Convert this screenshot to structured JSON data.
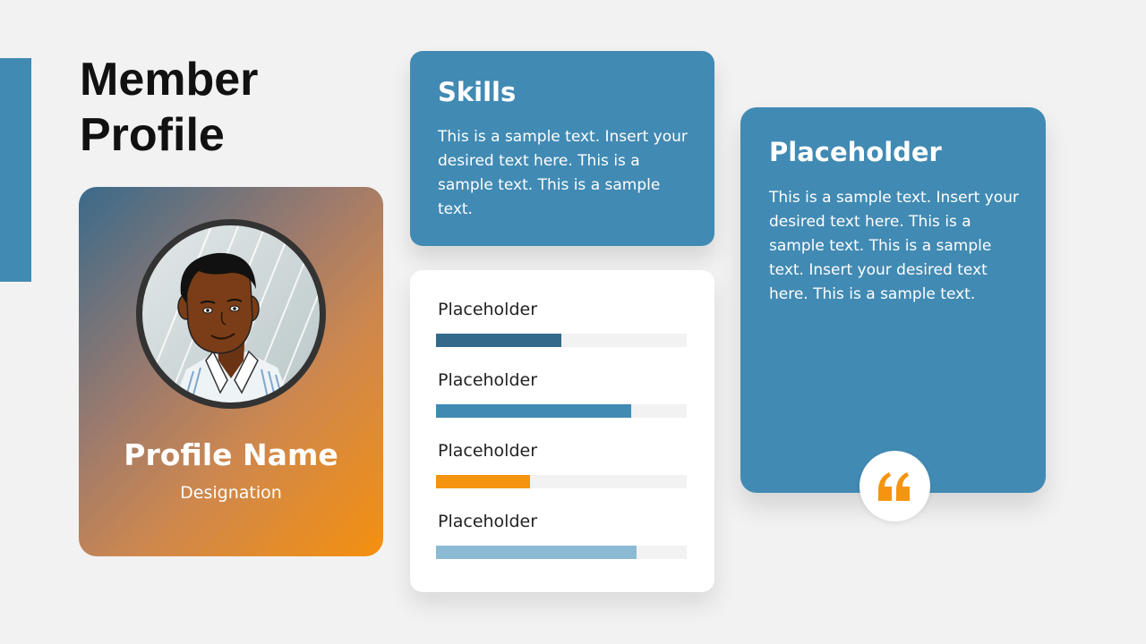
{
  "title": {
    "line1": "Member",
    "line2": "Profile"
  },
  "profile": {
    "name": "Profile Name",
    "designation": "Designation",
    "avatar_icon": "person-avatar-icon"
  },
  "skills_card": {
    "title": "Skills",
    "text": "This is a sample text. Insert your desired text here. This is a sample text. This is a sample text."
  },
  "skill_bars": {
    "items": [
      {
        "label": "Placeholder",
        "level": 0.5,
        "color": "#336a8b"
      },
      {
        "label": "Placeholder",
        "level": 0.78,
        "color": "#418ab3"
      },
      {
        "label": "Placeholder",
        "level": 0.375,
        "color": "#f5940f"
      },
      {
        "label": "Placeholder",
        "level": 0.8,
        "color": "#8cbad4"
      }
    ],
    "track_color": "#f2f2f2"
  },
  "quote_card": {
    "title": "Placeholder",
    "text": "This is a sample text. Insert your desired text here. This is a sample text. This is a sample text. Insert your desired text here. This is a sample text.",
    "icon": "quote-icon"
  },
  "colors": {
    "accent": "#418ab3",
    "orange": "#f5940f",
    "background": "#f2f2f2"
  }
}
